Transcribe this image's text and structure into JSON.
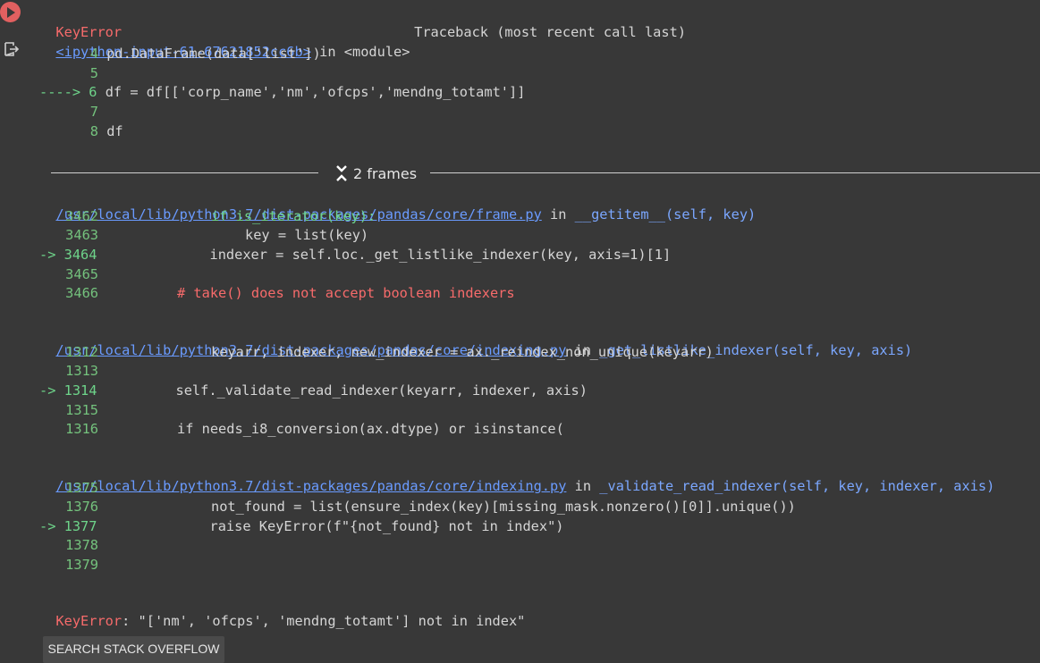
{
  "error_name": "KeyError",
  "traceback_header": "Traceback (most recent call last)",
  "input_cell": {
    "link": "<ipython-input-61-67621852cc6b>",
    "in_text": "in <module>",
    "lines": [
      {
        "arrow": "",
        "num": "4",
        "code": "pd.DataFrame(data['list'])"
      },
      {
        "arrow": "",
        "num": "5",
        "code": ""
      },
      {
        "arrow": "---->",
        "num": "6",
        "code": "df = df[['corp_name','nm','ofcps','mendng_totamt']]"
      },
      {
        "arrow": "",
        "num": "7",
        "code": ""
      },
      {
        "arrow": "",
        "num": "8",
        "code": "df"
      }
    ]
  },
  "frames_toggle": "2 frames",
  "frames": [
    {
      "path": "/usr/local/lib/python3.7/dist-packages/pandas/core/frame.py",
      "in_kw": "in",
      "func": "__getitem__(self, key)",
      "lines": [
        {
          "arrow": "",
          "num": "3462",
          "code": "if is_iterator(key):"
        },
        {
          "arrow": "",
          "num": "3463",
          "code": "key = list(key)"
        },
        {
          "arrow": "->",
          "num": "3464",
          "code": "indexer = self.loc._get_listlike_indexer(key, axis=1)[1]"
        },
        {
          "arrow": "",
          "num": "3465",
          "code": ""
        },
        {
          "arrow": "",
          "num": "3466",
          "code": "# take() does not accept boolean indexers"
        }
      ]
    },
    {
      "path": "/usr/local/lib/python3.7/dist-packages/pandas/core/indexing.py",
      "in_kw": "in",
      "func": "_get_listlike_indexer(self, key, axis)",
      "lines": [
        {
          "arrow": "",
          "num": "1312",
          "code": "keyarr, indexer, new_indexer = ax._reindex_non_unique(keyarr)"
        },
        {
          "arrow": "",
          "num": "1313",
          "code": ""
        },
        {
          "arrow": "->",
          "num": "1314",
          "code": "self._validate_read_indexer(keyarr, indexer, axis)"
        },
        {
          "arrow": "",
          "num": "1315",
          "code": ""
        },
        {
          "arrow": "",
          "num": "1316",
          "code": "if needs_i8_conversion(ax.dtype) or isinstance("
        }
      ]
    },
    {
      "path": "/usr/local/lib/python3.7/dist-packages/pandas/core/indexing.py",
      "in_kw": "in",
      "func": "_validate_read_indexer(self, key, indexer, axis)",
      "lines": [
        {
          "arrow": "",
          "num": "1375",
          "code": ""
        },
        {
          "arrow": "",
          "num": "1376",
          "code": "not_found = list(ensure_index(key)[missing_mask.nonzero()[0]].unique())"
        },
        {
          "arrow": "->",
          "num": "1377",
          "code": "raise KeyError(f\"{not_found} not in index\")"
        },
        {
          "arrow": "",
          "num": "1378",
          "code": ""
        },
        {
          "arrow": "",
          "num": "1379",
          "code": ""
        }
      ]
    }
  ],
  "final_error": {
    "name": "KeyError",
    "message": ": \"['nm', 'ofcps', 'mendng_totamt'] not in index\""
  },
  "search_button": "SEARCH STACK OVERFLOW",
  "colors": {
    "error": "#f76b6b",
    "link": "#6a9bff",
    "lineno": "#74c27d",
    "background": "#383838"
  }
}
